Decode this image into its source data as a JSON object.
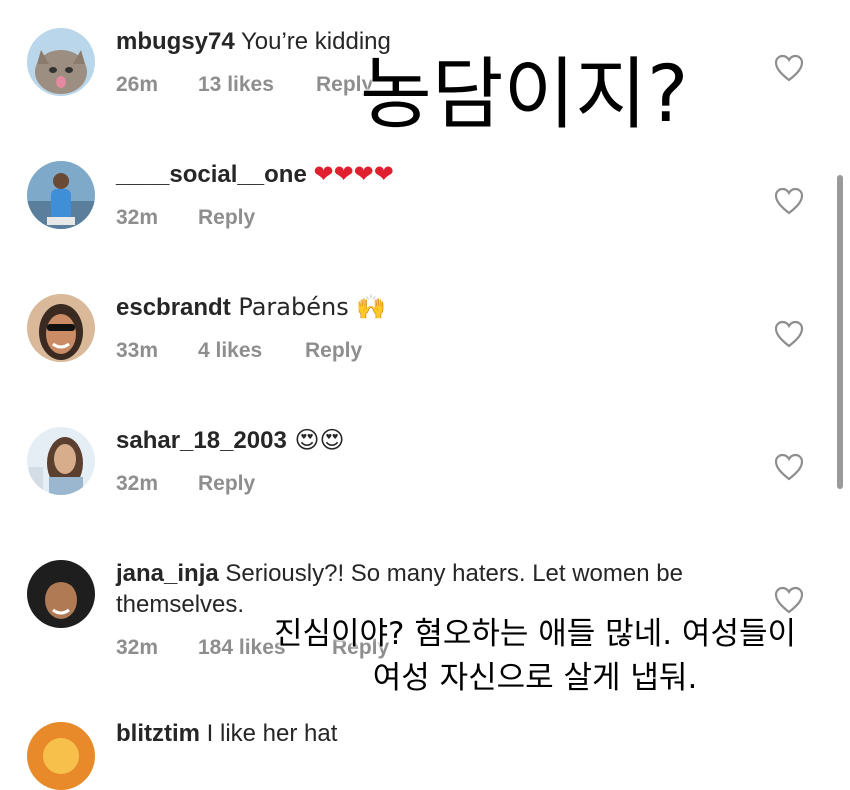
{
  "comments": [
    {
      "username": "mbugsy74",
      "text": " You’re kidding",
      "time": "26m",
      "likes": "13 likes",
      "reply": "Reply"
    },
    {
      "username": "____social__one",
      "text": " ❤❤❤❤",
      "time": "32m",
      "likes": "",
      "reply": "Reply"
    },
    {
      "username": "escbrandt",
      "text": " Parabéns 🙌",
      "time": "33m",
      "likes": "4 likes",
      "reply": "Reply"
    },
    {
      "username": "sahar_18_2003",
      "text": " 😍😍",
      "time": "32m",
      "likes": "",
      "reply": "Reply"
    },
    {
      "username": "jana_inja",
      "text": " Seriously?! So many haters. Let women be themselves.",
      "time": "32m",
      "likes": "184 likes",
      "reply": "Reply"
    },
    {
      "username": "blitztim",
      "text": " I like her hat",
      "time": "",
      "likes": "",
      "reply": ""
    }
  ],
  "captions": {
    "top": "농담이지?",
    "bottom_line1": "진심이야? 혐오하는 애들 많네. 여성들이",
    "bottom_line2": "여성 자신으로 살게 냅둬."
  },
  "colors": {
    "text": "#262626",
    "meta": "#8e8e8e",
    "heart_emoji": "#e0202e"
  }
}
